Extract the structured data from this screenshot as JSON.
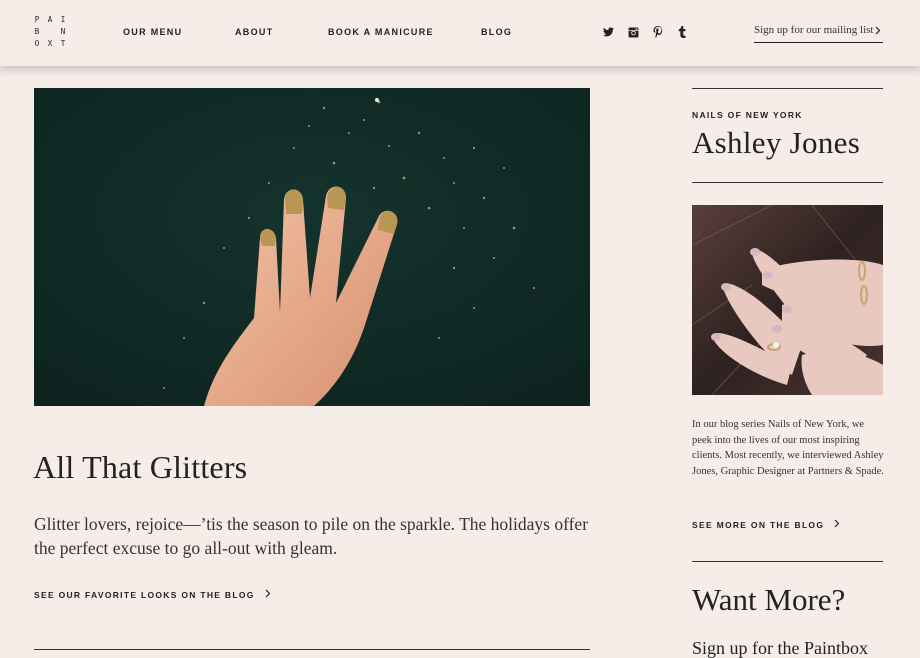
{
  "header": {
    "logo_rows": [
      [
        "P",
        "A",
        "I"
      ],
      [
        "B",
        "",
        "N"
      ],
      [
        "O",
        "X",
        "T"
      ]
    ],
    "nav": [
      {
        "label": "OUR MENU"
      },
      {
        "label": "ABOUT"
      },
      {
        "label": "BOOK A MANICURE"
      },
      {
        "label": "BLOG"
      }
    ],
    "social_icons": [
      "twitter-icon",
      "instagram-icon",
      "pinterest-icon",
      "tumblr-icon"
    ],
    "signup_label": "Sign up for our mailing list"
  },
  "main": {
    "post_title": "All That Glitters",
    "post_description": "Glitter lovers, rejoice—’tis the season to pile on the sparkle. The holidays offer the perfect excuse to go all-out with gleam.",
    "cta_label": "SEE OUR FAVORITE LOOKS ON THE BLOG"
  },
  "sidebar": {
    "eyebrow": "NAILS OF NEW YORK",
    "name": "Ashley Jones",
    "description": "In our blog series Nails of New York, we peek into the lives of our most inspiring clients. Most recently, we interviewed Ashley Jones, Graphic Designer at Partners & Spade.",
    "cta_label": "SEE MORE ON THE BLOG",
    "want_more": "Want More?",
    "signup_heading": "Sign up for the Paintbox"
  },
  "colors": {
    "background": "#f6ede8",
    "text": "#222222",
    "hero_bg": "#102a25"
  }
}
